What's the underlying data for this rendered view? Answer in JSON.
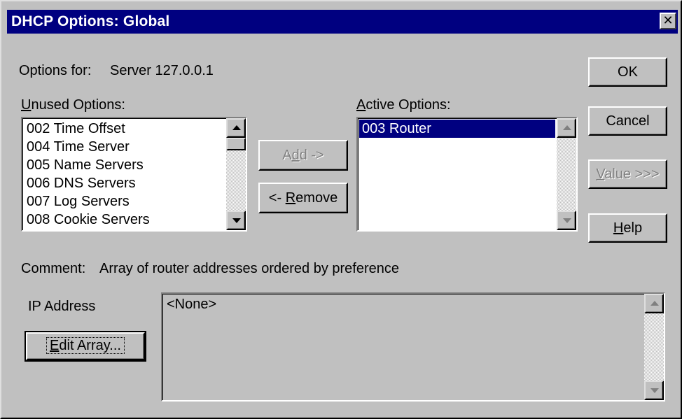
{
  "window": {
    "title": "DHCP Options: Global",
    "close_glyph": "✕"
  },
  "header": {
    "options_for_label": "Options for:",
    "options_for_value": "Server 127.0.0.1"
  },
  "unused": {
    "label_mnemonic": "U",
    "label_rest": "nused Options:",
    "items": [
      "002 Time Offset",
      "004 Time Server",
      "005 Name Servers",
      "006 DNS Servers",
      "007 Log Servers",
      "008 Cookie Servers"
    ]
  },
  "active": {
    "label_mnemonic": "A",
    "label_rest": "ctive Options:",
    "items": [
      "003 Router"
    ],
    "selected_index": 0
  },
  "buttons": {
    "add_pre": "A",
    "add_mnemonic": "d",
    "add_post": "d ->",
    "remove_pre": "<- ",
    "remove_mnemonic": "R",
    "remove_post": "emove",
    "ok": "OK",
    "cancel": "Cancel",
    "value_mnemonic": "V",
    "value_post": "alue >>>",
    "help_mnemonic": "H",
    "help_post": "elp",
    "edit_array_mnemonic": "E",
    "edit_array_post": "dit Array..."
  },
  "comment": {
    "label": "Comment:",
    "text": "Array of router addresses ordered by preference"
  },
  "value_area": {
    "label": "IP Address",
    "content": "<None>"
  },
  "icons": {
    "close": "close-icon",
    "scroll_up": "scroll-up-arrow-icon",
    "scroll_down": "scroll-down-arrow-icon"
  }
}
